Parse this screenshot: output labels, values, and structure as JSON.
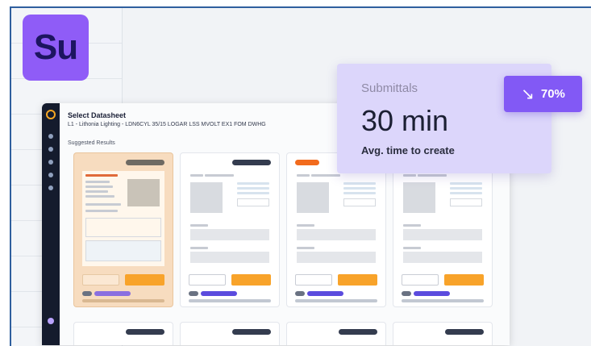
{
  "brand": {
    "logo_text": "Su",
    "logo_color": "#8f5cf7"
  },
  "app": {
    "title": "Select Datasheet",
    "subtitle": "L1 - Lithonia Lighting - LDN6CYL 35/15 LOGAR LSS MVOLT EX1 FOM DWHG",
    "section_label": "Suggested Results"
  },
  "stat_card": {
    "label": "Submittals",
    "value": "30 min",
    "caption": "Avg. time to create",
    "badge_icon": "arrow-down-right-icon",
    "badge_glyph": "↘",
    "badge_text": "70%"
  },
  "colors": {
    "accent_orange": "#f8a32a",
    "accent_purple": "#8259f5",
    "rail": "#141b2d"
  }
}
